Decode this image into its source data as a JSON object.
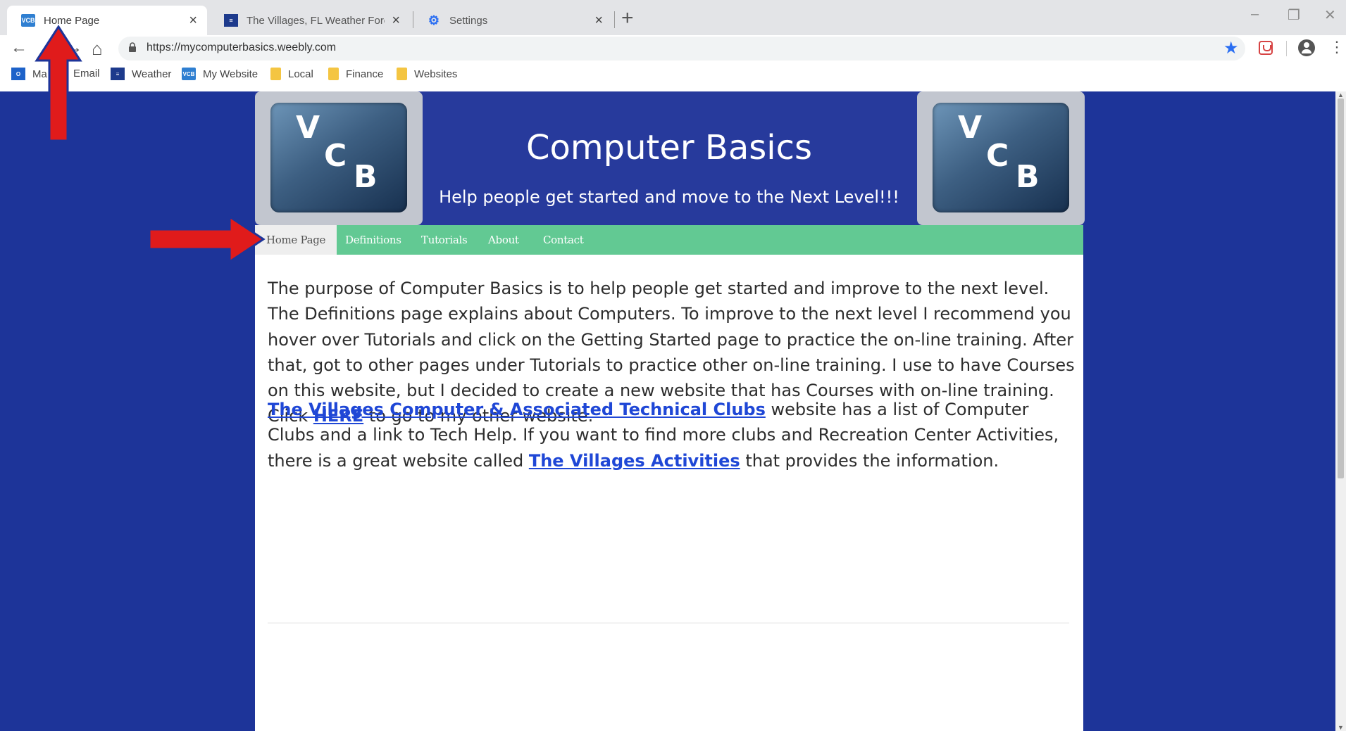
{
  "browser": {
    "tabs": [
      {
        "title": "Home Page",
        "icon": "vcb-favicon",
        "active": true
      },
      {
        "title": "The Villages, FL Weather Forecas",
        "icon": "weather-favicon",
        "active": false
      },
      {
        "title": "Settings",
        "icon": "gear-icon",
        "active": false
      }
    ],
    "new_tab_label": "+",
    "window_controls": {
      "minimize": "–",
      "restore": "❐",
      "close": "✕"
    },
    "url": "https://mycomputerbasics.weebly.com",
    "bookmarks": [
      {
        "label": "Ma",
        "icon": "outlook-icon"
      },
      {
        "label": "Email",
        "icon": ""
      },
      {
        "label": "Weather",
        "icon": "weather-favicon"
      },
      {
        "label": "My Website",
        "icon": "vcb-favicon"
      },
      {
        "label": "Local",
        "icon": "folder-icon"
      },
      {
        "label": "Finance",
        "icon": "folder-icon"
      },
      {
        "label": "Websites",
        "icon": "folder-icon"
      }
    ]
  },
  "site": {
    "logo_letters": {
      "v": "V",
      "c": "C",
      "b": "B"
    },
    "title": "Computer Basics",
    "tagline": "Help people get started and move to the Next Level!!!",
    "nav": [
      "Home Page",
      "Definitions",
      "Tutorials",
      "About",
      "Contact"
    ],
    "active_nav": "Home Page"
  },
  "content": {
    "para1_before": "The purpose of Computer Basics is to help people get started and improve to the next level. The Definitions page explains about Computers.  To improve to the next level I recommend you hover over Tutorials and click on the Getting Started page to practice the on-line training.  After that, got to other pages under Tutorials to practice other on-line training.  I use to have Courses on this website, but I decided to create a new website that has Courses with on-line training.  Click ",
    "para1_link": "HERE",
    "para1_after": " to go to my other website.",
    "para2_link1": "The Villages Computer & Associated Technical Clubs",
    "para2_mid": " website has a list of Computer Clubs and a link to Tech Help.  If you want to find more clubs and Recreation Center Activities, there is a great website called ",
    "para2_link2": "The Villages Activities",
    "para2_after": " that provides the information."
  },
  "colors": {
    "page_background": "#1d3499",
    "header_background": "#273a9c",
    "nav_background": "#62c993",
    "link": "#1f47d6",
    "annotation_arrow": "#e01b1b"
  }
}
